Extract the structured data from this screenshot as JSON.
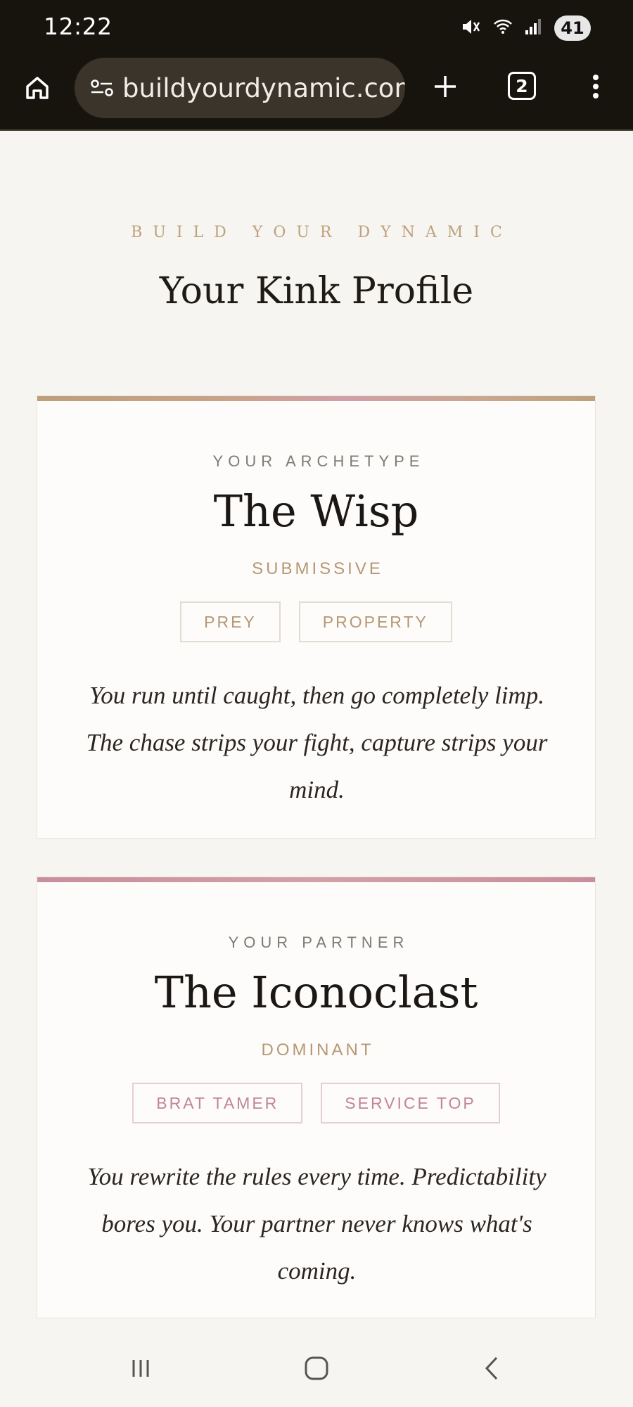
{
  "status_bar": {
    "time": "12:22",
    "battery": "41",
    "icons": [
      "mute-icon",
      "wifi-icon",
      "signal-icon",
      "battery-icon"
    ]
  },
  "browser": {
    "url": "buildyourdynamic.com",
    "tab_count": "2",
    "icons": [
      "home-icon",
      "site-info-icon",
      "new-tab-icon",
      "more-menu-icon"
    ]
  },
  "page": {
    "eyebrow": "BUILD YOUR DYNAMIC",
    "title": "Your Kink Profile"
  },
  "cards": [
    {
      "label": "YOUR ARCHETYPE",
      "name": "The Wisp",
      "role": "SUBMISSIVE",
      "tags": [
        "PREY",
        "PROPERTY"
      ],
      "description": "You run until caught, then go completely limp. The chase strips your fight, capture strips your mind."
    },
    {
      "label": "YOUR PARTNER",
      "name": "The Iconoclast",
      "role": "DOMINANT",
      "tags": [
        "BRAT TAMER",
        "SERVICE TOP"
      ],
      "description": "You rewrite the rules every time. Predictability bores you. Your partner never knows what's coming."
    }
  ],
  "colors": {
    "gold_accent": "#bda27c",
    "rose_accent": "#c98e9b",
    "browser_chrome": "#17130d",
    "page_bg": "#f7f5f1"
  },
  "nav_bar": {
    "icons": [
      "recent-apps-icon",
      "home-nav-icon",
      "back-icon"
    ]
  }
}
